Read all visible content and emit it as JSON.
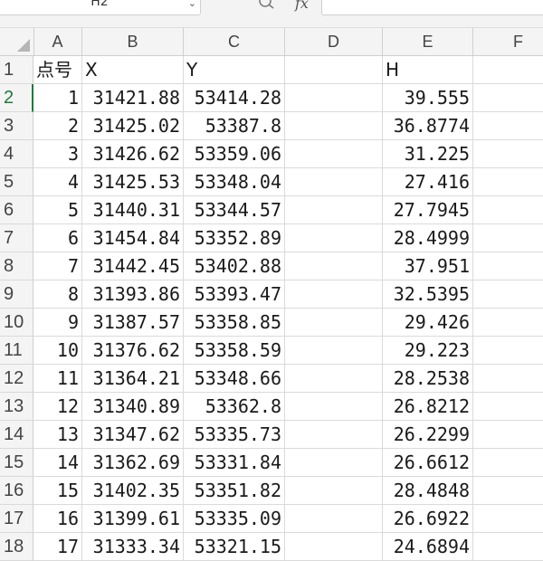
{
  "formula_bar": {
    "name_box": "H2",
    "fx_label": "fx",
    "formula_value": ""
  },
  "columns": [
    "A",
    "B",
    "C",
    "D",
    "E",
    "F"
  ],
  "rows": [
    {
      "num": "1",
      "a": "点号",
      "b": "X",
      "c": "Y",
      "d": "",
      "e": "H"
    },
    {
      "num": "2",
      "a": "1",
      "b": "31421.88",
      "c": "53414.28",
      "d": "",
      "e": "39.555"
    },
    {
      "num": "3",
      "a": "2",
      "b": "31425.02",
      "c": "53387.8",
      "d": "",
      "e": "36.8774"
    },
    {
      "num": "4",
      "a": "3",
      "b": "31426.62",
      "c": "53359.06",
      "d": "",
      "e": "31.225"
    },
    {
      "num": "5",
      "a": "4",
      "b": "31425.53",
      "c": "53348.04",
      "d": "",
      "e": "27.416"
    },
    {
      "num": "6",
      "a": "5",
      "b": "31440.31",
      "c": "53344.57",
      "d": "",
      "e": "27.7945"
    },
    {
      "num": "7",
      "a": "6",
      "b": "31454.84",
      "c": "53352.89",
      "d": "",
      "e": "28.4999"
    },
    {
      "num": "8",
      "a": "7",
      "b": "31442.45",
      "c": "53402.88",
      "d": "",
      "e": "37.951"
    },
    {
      "num": "9",
      "a": "8",
      "b": "31393.86",
      "c": "53393.47",
      "d": "",
      "e": "32.5395"
    },
    {
      "num": "10",
      "a": "9",
      "b": "31387.57",
      "c": "53358.85",
      "d": "",
      "e": "29.426"
    },
    {
      "num": "11",
      "a": "10",
      "b": "31376.62",
      "c": "53358.59",
      "d": "",
      "e": "29.223"
    },
    {
      "num": "12",
      "a": "11",
      "b": "31364.21",
      "c": "53348.66",
      "d": "",
      "e": "28.2538"
    },
    {
      "num": "13",
      "a": "12",
      "b": "31340.89",
      "c": "53362.8",
      "d": "",
      "e": "26.8212"
    },
    {
      "num": "14",
      "a": "13",
      "b": "31347.62",
      "c": "53335.73",
      "d": "",
      "e": "26.2299"
    },
    {
      "num": "15",
      "a": "14",
      "b": "31362.69",
      "c": "53331.84",
      "d": "",
      "e": "26.6612"
    },
    {
      "num": "16",
      "a": "15",
      "b": "31402.35",
      "c": "53351.82",
      "d": "",
      "e": "28.4848"
    },
    {
      "num": "17",
      "a": "16",
      "b": "31399.61",
      "c": "53335.09",
      "d": "",
      "e": "26.6922"
    },
    {
      "num": "18",
      "a": "17",
      "b": "31333.34",
      "c": "53321.15",
      "d": "",
      "e": "24.6894"
    }
  ],
  "active_row": "2",
  "colors": {
    "active_row_header": "#1e7a3c"
  }
}
